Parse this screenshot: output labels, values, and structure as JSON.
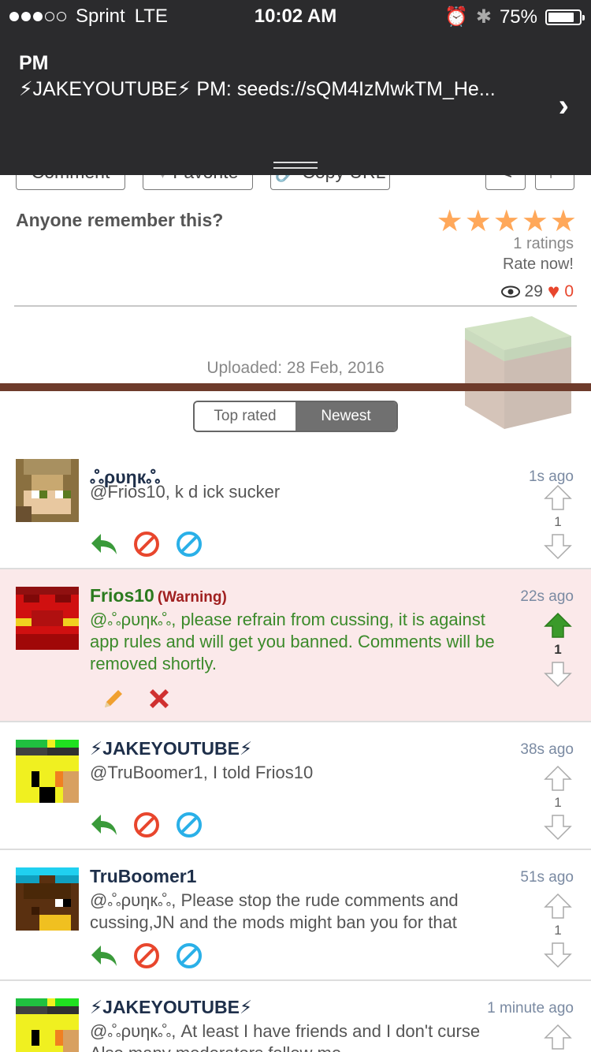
{
  "status": {
    "carrier": "Sprint",
    "network": "LTE",
    "time": "10:02 AM",
    "battery": "75%"
  },
  "notification": {
    "title": "PM",
    "message": "⚡JAKEYOUTUBE⚡ PM: seeds://sQM4IzMwkTM_He..."
  },
  "toolbar": {
    "comment": "Comment",
    "favorite": "Favorite",
    "copy_url": "Copy URL"
  },
  "post": {
    "title": "Anyone remember this?",
    "ratings": "1 ratings",
    "rate_now": "Rate now!",
    "views": "29",
    "likes": "0",
    "uploaded": "Uploaded: 28 Feb, 2016"
  },
  "tabs": {
    "top_rated": "Top rated",
    "newest": "Newest"
  },
  "comments": [
    {
      "user": "ஃρυηкஃ",
      "time": "1s ago",
      "text": "@Frios10, k d ick sucker",
      "votes": "1"
    },
    {
      "user": "Frios10",
      "warning": "(Warning)",
      "time": "22s ago",
      "text": "@ஃρυηкஃ, please refrain from cussing, it is against app rules and will get you banned. Comments will be removed shortly.",
      "votes": "1"
    },
    {
      "user": "⚡JAKEYOUTUBE⚡",
      "time": "38s ago",
      "text": "@TruBoomer1, I told Frios10",
      "votes": "1"
    },
    {
      "user": "TruBoomer1",
      "time": "51s ago",
      "text": "@ஃρυηкஃ, Please stop the rude comments and cussing,JN and the mods might ban you for that",
      "votes": "1"
    },
    {
      "user": "⚡JAKEYOUTUBE⚡",
      "time": "1 minute ago",
      "text": "@ஃρυηкஃ, At least I have friends and I don't curse Also many moderators follow me",
      "votes": ""
    }
  ],
  "colors": {
    "banner": "#2b2b2d",
    "star": "#ffa85a",
    "warning_bg": "#fbe9ea",
    "upvote_active": "#3a9a2a"
  }
}
